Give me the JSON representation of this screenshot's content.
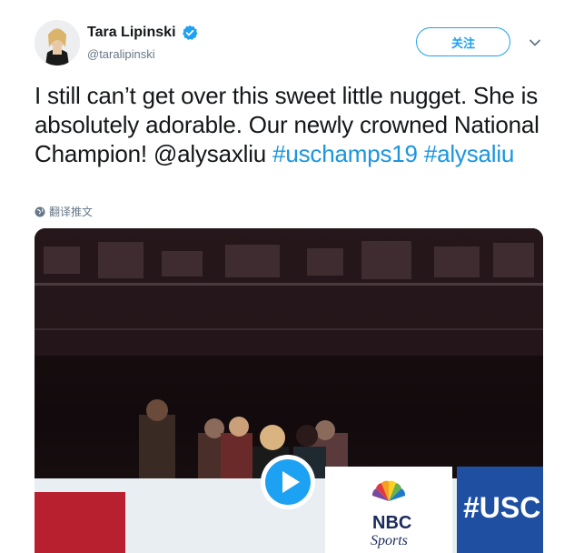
{
  "author": {
    "display_name": "Tara Lipinski",
    "handle": "@taralipinski",
    "verified": true,
    "avatar": "profile-photo"
  },
  "actions": {
    "follow_label": "关注",
    "menu_icon": "chevron-down-icon"
  },
  "tweet": {
    "segments": [
      {
        "text": "I still can’t get over this sweet little nugget. She is absolutely adorable. Our newly crowned National Champion! @alysaxliu ",
        "type": "text"
      },
      {
        "text": "#uschamps19",
        "type": "hashtag"
      },
      {
        "text": " ",
        "type": "text"
      },
      {
        "text": "#alysaliu",
        "type": "hashtag"
      }
    ]
  },
  "translate": {
    "label": "翻译推文",
    "icon": "globe-icon"
  },
  "media": {
    "type": "video",
    "play_icon": "play-icon",
    "board_text": "#USC",
    "logo_text_1": "NBC",
    "logo_text_2": "Sports"
  },
  "colors": {
    "accent": "#1da1f2",
    "hashtag": "#1b95e0",
    "text": "#14171a",
    "muted": "#657786"
  }
}
